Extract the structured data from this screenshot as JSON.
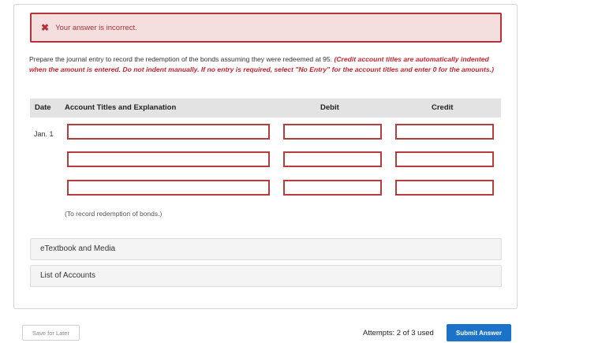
{
  "alert": {
    "icon": "close-icon",
    "message": "Your answer is incorrect."
  },
  "instructions": {
    "text": "Prepare the journal entry to record the redemption of the bonds assuming they were redeemed at 95. ",
    "emphasis": "(Credit account titles are automatically indented when the amount is entered. Do not indent manually. If no entry is required, select \"No Entry\" for the account titles and enter 0 for the amounts.)"
  },
  "table": {
    "headers": {
      "date": "Date",
      "account": "Account Titles and Explanation",
      "debit": "Debit",
      "credit": "Credit"
    },
    "date_value": "Jan. 1",
    "rows": [
      {
        "account": "",
        "debit": "",
        "credit": ""
      },
      {
        "account": "",
        "debit": "",
        "credit": ""
      },
      {
        "account": "",
        "debit": "",
        "credit": ""
      }
    ],
    "explanation": "(To record redemption of bonds.)"
  },
  "accordions": {
    "etextbook": "eTextbook and Media",
    "accounts": "List of Accounts"
  },
  "footer": {
    "save_label": "Save for Later",
    "attempts": "Attempts: 2 of 3 used",
    "submit_label": "Submit Answer"
  },
  "colors": {
    "error_border": "#b3333a",
    "error_bg": "#f4dede",
    "submit_bg": "#1a73c9"
  }
}
